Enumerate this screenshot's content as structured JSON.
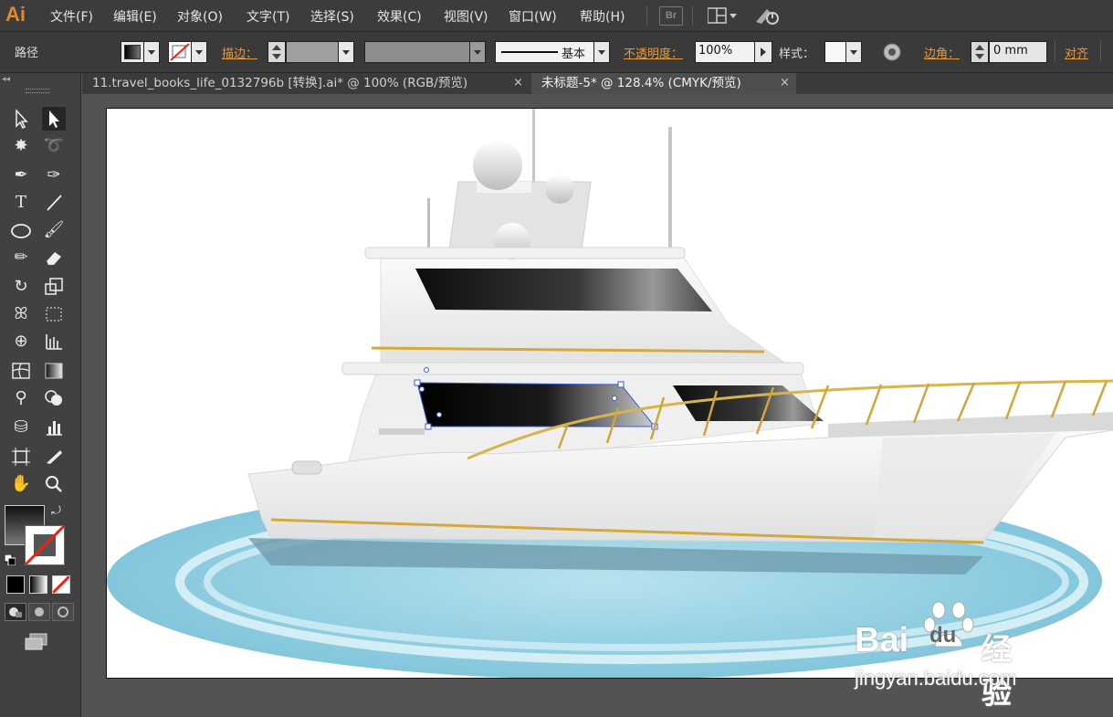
{
  "app": {
    "logo": "Ai"
  },
  "menus": [
    "文件(F)",
    "编辑(E)",
    "对象(O)",
    "文字(T)",
    "选择(S)",
    "效果(C)",
    "视图(V)",
    "窗口(W)",
    "帮助(H)"
  ],
  "bridge_label": "Br",
  "control": {
    "object_type": "路径",
    "stroke_label": "描边：",
    "brush_label": "基本",
    "opacity_label": "不透明度：",
    "opacity_value": "100%",
    "style_label": "样式：",
    "corner_label": "边角：",
    "corner_value": "0 mm",
    "align_label": "对齐"
  },
  "tabs": [
    {
      "label": "11.travel_books_life_0132796b [转换].ai* @ 100% (RGB/预览)",
      "close": "×"
    },
    {
      "label": "未标题-5* @ 128.4% (CMYK/预览)",
      "close": "×"
    }
  ],
  "tools": [
    "selection-icon",
    "direct-selection-icon",
    "magic-wand-icon",
    "lasso-icon",
    "pen-icon",
    "curvature-icon",
    "type-icon",
    "line-icon",
    "ellipse-icon",
    "brush-icon",
    "pencil-icon",
    "eraser-icon",
    "rotate-icon",
    "scale-icon",
    "warp-icon",
    "free-transform-icon",
    "shape-builder-icon",
    "graph-icon",
    "mesh-icon",
    "gradient-icon",
    "eyedropper-icon",
    "blend-icon",
    "symbol-sprayer-icon",
    "column-graph-icon",
    "artboard-icon",
    "slice-icon",
    "hand-icon",
    "zoom-icon"
  ],
  "watermark": {
    "brand_a": "Bai",
    "brand_b": "du",
    "brand_cn": "经验",
    "url": "jingyan.baidu.com"
  },
  "colors": {
    "accent_orange": "#e89a38",
    "logo": "#e08a2e",
    "water": "#8fcde0",
    "selection": "#3a5bd9"
  }
}
